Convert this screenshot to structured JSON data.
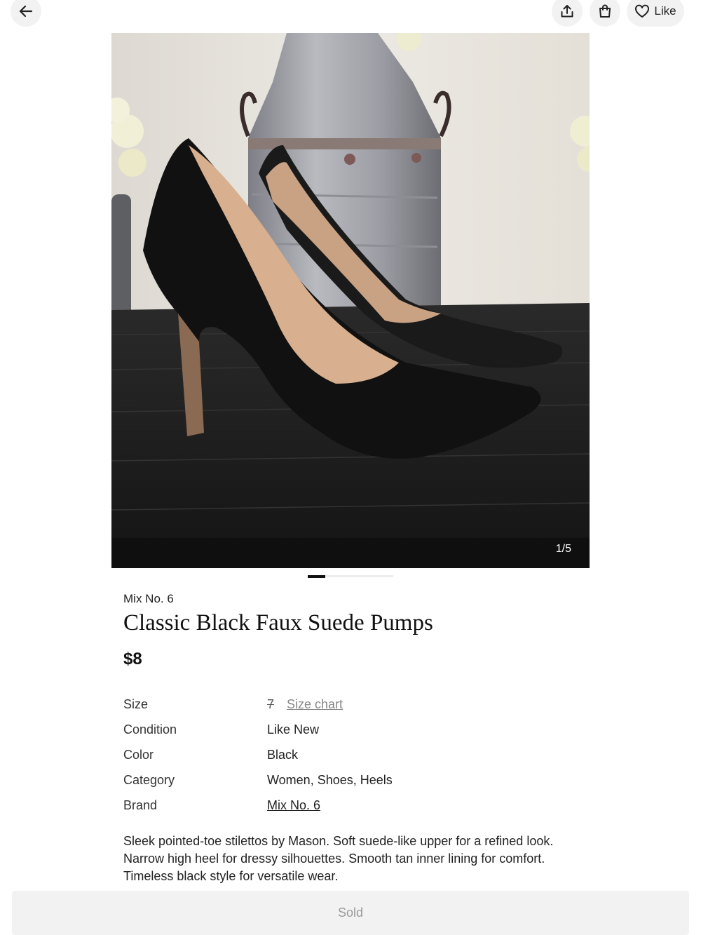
{
  "header": {
    "like_label": "Like"
  },
  "photo": {
    "counter": "1/5"
  },
  "pager": {
    "current": 1,
    "total": 5
  },
  "product": {
    "brand": "Mix No. 6",
    "title": "Classic Black Faux Suede Pumps",
    "price": "$8",
    "details": {
      "size_label": "Size",
      "size_value": "7",
      "size_chart_label": "Size chart",
      "condition_label": "Condition",
      "condition_value": "Like New",
      "color_label": "Color",
      "color_value": "Black",
      "category_label": "Category",
      "category_value": "Women, Shoes, Heels",
      "brand_label": "Brand",
      "brand_value": "Mix No. 6"
    },
    "description": "Sleek pointed-toe stilettos by Mason. Soft suede-like upper for a refined look. Narrow high heel for dressy silhouettes. Smooth tan inner lining for comfort. Timeless black style for versatile wear."
  },
  "footer": {
    "sold_label": "Sold"
  },
  "icons": {
    "back": "arrow-left-icon",
    "share": "share-icon",
    "bag": "shopping-bag-icon",
    "like": "heart-icon"
  }
}
